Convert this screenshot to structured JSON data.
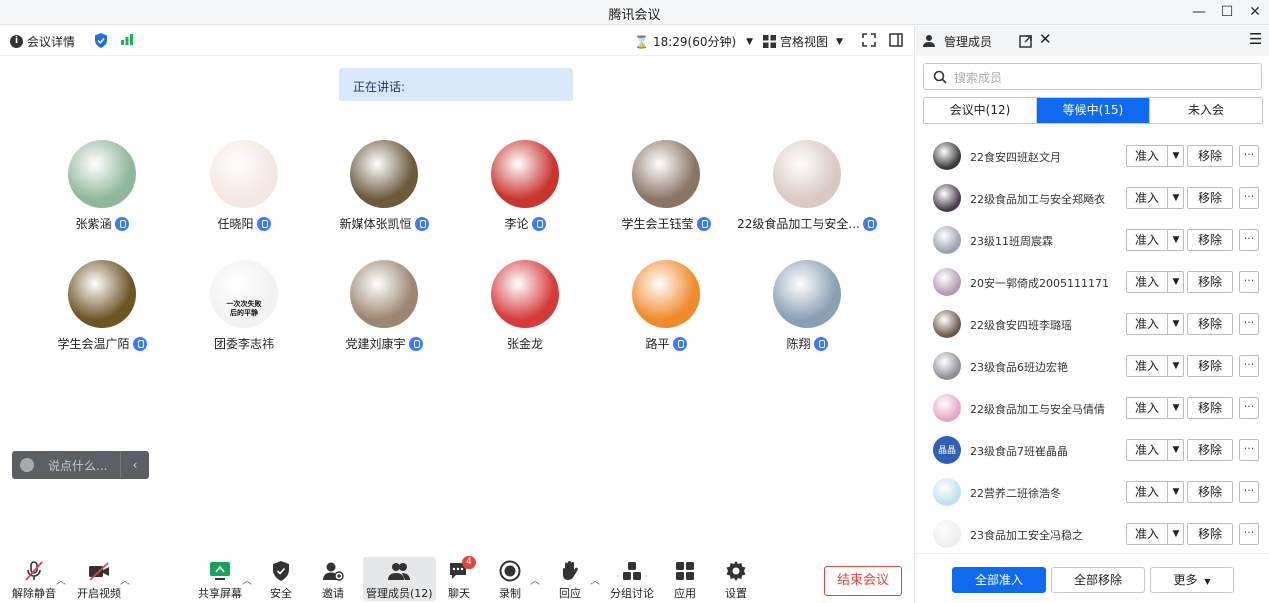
{
  "window": {
    "title": "腾讯会议"
  },
  "infobar": {
    "details_label": "会议详情",
    "timer": "18:29(60分钟)",
    "view_label": "宫格视图"
  },
  "stage": {
    "speaking_label": "正在讲话:",
    "participants": [
      {
        "name": "张紫涵",
        "mic": true,
        "color": "#8fb79a"
      },
      {
        "name": "任晓阳",
        "mic": true,
        "color": "#f3e7e1"
      },
      {
        "name": "新媒体张凯恒",
        "mic": true,
        "color": "#6b5a3c"
      },
      {
        "name": "李论",
        "mic": true,
        "color": "#c9342f"
      },
      {
        "name": "学生会王钰莹",
        "mic": true,
        "color": "#8a7565"
      },
      {
        "name": "22级食品加工与安全...",
        "mic": true,
        "color": "#d9c9c2"
      },
      {
        "name": "学生会温广陌",
        "mic": true,
        "color": "#6e5526"
      },
      {
        "name": "团委李志祎",
        "mic": false,
        "color": "#f2f2f2",
        "sticker_text": "一次次失败\n后的平静"
      },
      {
        "name": "党建刘康宇",
        "mic": true,
        "color": "#9b8673"
      },
      {
        "name": "张金龙",
        "mic": false,
        "color": "#d63b3b"
      },
      {
        "name": "路平",
        "mic": true,
        "color": "#f08a2c"
      },
      {
        "name": "陈翔",
        "mic": true,
        "color": "#8aa0b5"
      }
    ],
    "chat_placeholder": "说点什么..."
  },
  "toolbar": {
    "unmute": "解除静音",
    "start_video": "开启视频",
    "share_screen": "共享屏幕",
    "security": "安全",
    "invite": "邀请",
    "manage_members": "管理成员(12)",
    "chat": "聊天",
    "chat_badge": "4",
    "record": "录制",
    "reactions": "回应",
    "breakout": "分组讨论",
    "apps": "应用",
    "settings": "设置",
    "end_meeting": "结束会议"
  },
  "panel": {
    "title": "管理成员",
    "search_placeholder": "搜索成员",
    "tabs": [
      {
        "label": "会议中(12)",
        "active": false
      },
      {
        "label": "等候中(15)",
        "active": true
      },
      {
        "label": "未入会",
        "active": false
      }
    ],
    "admit_label": "准入",
    "remove_label": "移除",
    "more_label": "···",
    "waiting": [
      {
        "name": "22食安四班赵文月",
        "color": "#3a3a3a"
      },
      {
        "name": "22级食品加工与安全郑飏衣",
        "color": "#4d3a4d"
      },
      {
        "name": "23级11班周宸霖",
        "color": "#9aa4ad"
      },
      {
        "name": "20安一郭倚成2005111171",
        "color": "#b79ab5"
      },
      {
        "name": "22级食安四班李璐瑶",
        "color": "#6d5a4a"
      },
      {
        "name": "23级食品6班边宏艳",
        "color": "#8f8f9a"
      },
      {
        "name": "22级食品加工与安全马倩倩",
        "color": "#e6a6c4"
      },
      {
        "name": "23级食品7班崔晶晶",
        "color": "#2f5fb6",
        "initials": "晶晶"
      },
      {
        "name": "22营养二班徐浩冬",
        "color": "#bfe1f0"
      },
      {
        "name": "23食品加工安全冯稳之",
        "color": "#eeeeee"
      }
    ],
    "footer": {
      "admit_all": "全部准入",
      "remove_all": "全部移除",
      "more": "更多"
    }
  }
}
